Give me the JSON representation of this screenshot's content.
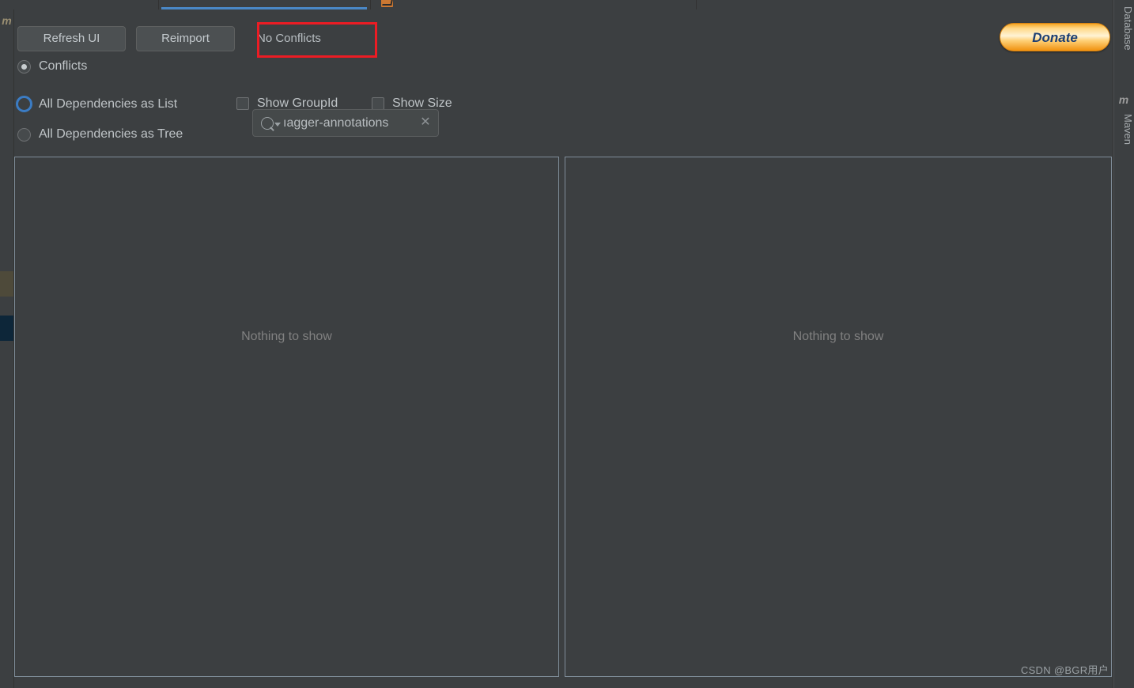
{
  "window": {
    "background_color": "#3c3f41",
    "accent_color": "#4a88c7",
    "highlight_color": "#ec1c24"
  },
  "tabs": [
    {
      "label": "",
      "active": false
    },
    {
      "label": "",
      "active": true
    },
    {
      "label": "",
      "active": false
    }
  ],
  "left_gutter": {
    "maven_mark": "m"
  },
  "toolbar": {
    "refresh_label": "Refresh UI",
    "reimport_label": "Reimport",
    "no_conflicts_label": "No Conflicts",
    "donate_label": "Donate"
  },
  "options": {
    "radios": [
      {
        "label": "Conflicts",
        "selected": true,
        "focused": false
      },
      {
        "label": "All Dependencies as List",
        "selected": false,
        "focused": true
      },
      {
        "label": "All Dependencies as Tree",
        "selected": false,
        "focused": false
      }
    ],
    "checkboxes": [
      {
        "label": "Show GroupId",
        "checked": false
      },
      {
        "label": "Show Size",
        "checked": false
      }
    ]
  },
  "search": {
    "value": "ıagger-annotations",
    "placeholder": "Search",
    "clear_glyph": "✕"
  },
  "panels": {
    "left": {
      "empty_text": "Nothing to show"
    },
    "right": {
      "empty_text": "Nothing to show"
    }
  },
  "right_sidebar": {
    "database_label": "Database",
    "maven_label": "Maven",
    "maven_icon": "m"
  },
  "watermark": "CSDN @BGR用户"
}
